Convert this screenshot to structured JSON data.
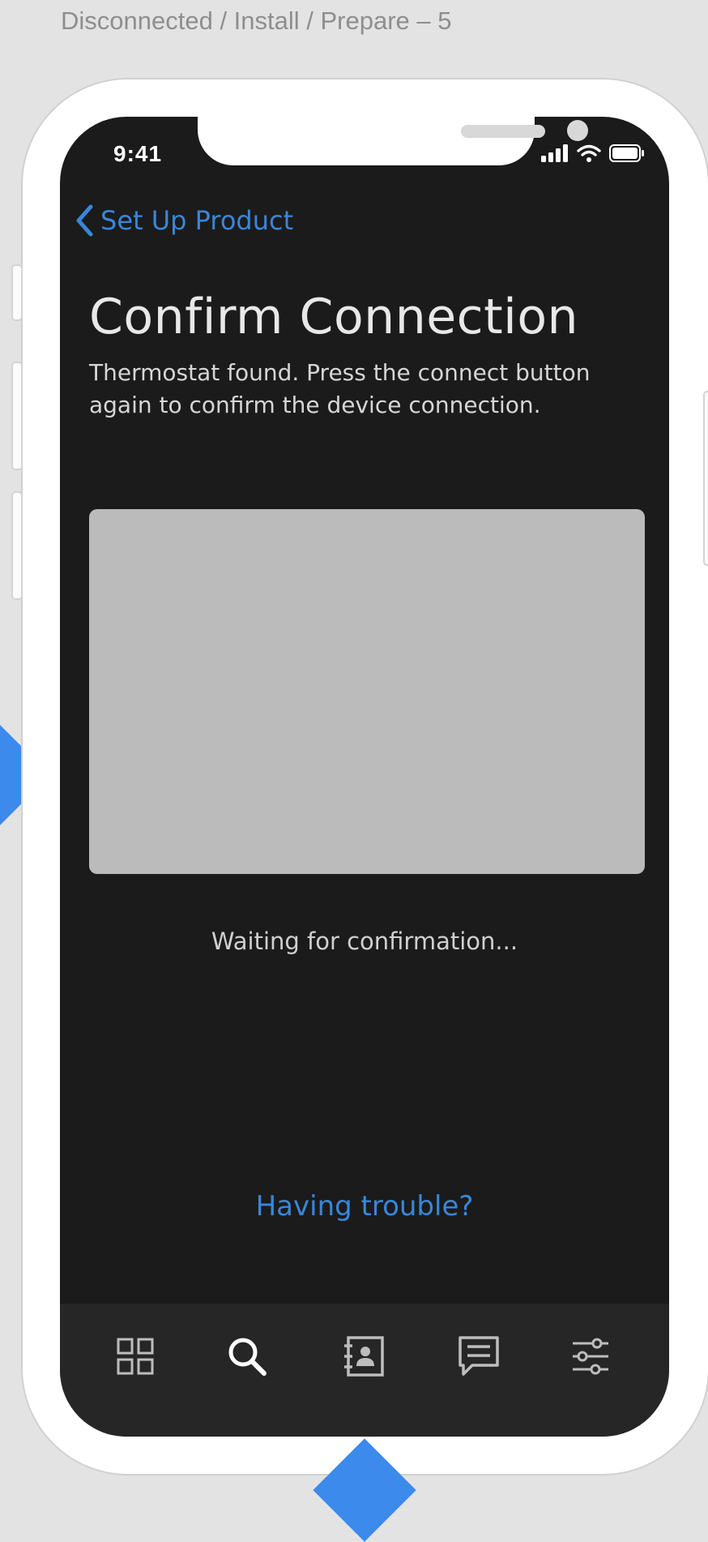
{
  "canvas": {
    "frame_label": "Disconnected / Install / Prepare – 5"
  },
  "status_bar": {
    "time": "9:41",
    "icons": [
      "cellular-signal-icon",
      "wifi-icon",
      "battery-icon"
    ]
  },
  "navigation": {
    "back_label": "Set Up Product",
    "back_icon": "chevron-left-icon"
  },
  "main": {
    "title": "Confirm Connection",
    "subtitle": "Thermostat found. Press the connect button again to confirm the device connection.",
    "status_text": "Waiting for confirmation...",
    "help_link": "Having trouble?"
  },
  "tab_bar": {
    "items": [
      {
        "icon": "grid-icon",
        "active": false
      },
      {
        "icon": "search-icon",
        "active": true
      },
      {
        "icon": "contacts-icon",
        "active": false
      },
      {
        "icon": "chat-icon",
        "active": false
      },
      {
        "icon": "sliders-icon",
        "active": false
      }
    ]
  },
  "colors": {
    "accent": "#3a86d9",
    "screen_background": "#1b1b1b",
    "tab_bar_background": "#262626",
    "placeholder": "#bbbbbb",
    "connector": "#3b8aec"
  }
}
